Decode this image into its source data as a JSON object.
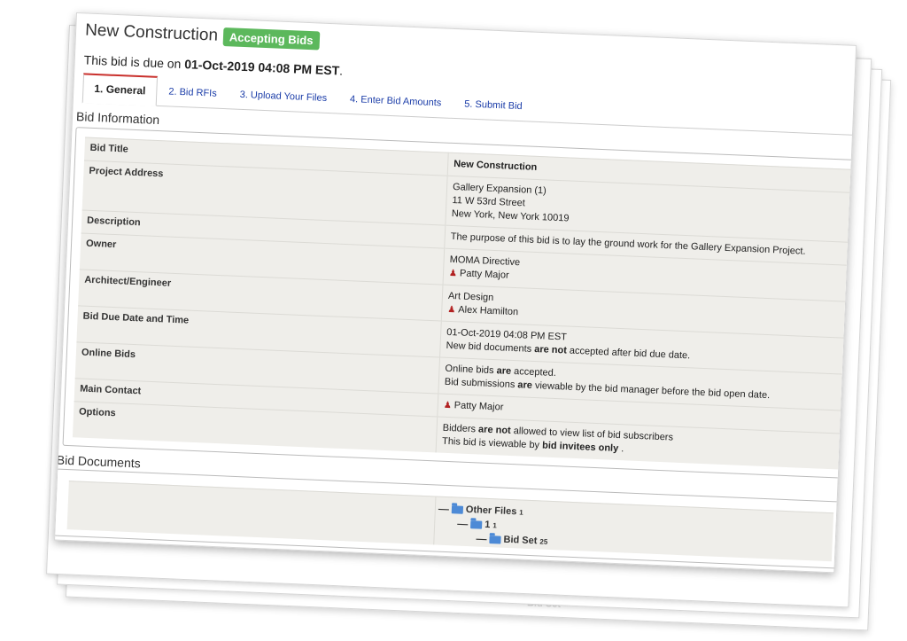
{
  "header": {
    "title": "New Construction",
    "status_badge": "Accepting Bids"
  },
  "due": {
    "prefix": "This bid is due on",
    "date": "01-Oct-2019 04:08 PM EST",
    "suffix": "."
  },
  "tabs": [
    {
      "label": "1. General",
      "active": true
    },
    {
      "label": "2. Bid RFIs",
      "active": false
    },
    {
      "label": "3. Upload Your Files",
      "active": false
    },
    {
      "label": "4. Enter Bid Amounts",
      "active": false
    },
    {
      "label": "5. Submit Bid",
      "active": false
    }
  ],
  "bid_information": {
    "heading": "Bid Information",
    "rows": {
      "bid_title": {
        "label": "Bid Title",
        "value": "New Construction"
      },
      "project_address": {
        "label": "Project Address",
        "line1": "Gallery Expansion (1)",
        "line2": "11 W 53rd Street",
        "line3": "New York, New York 10019"
      },
      "description": {
        "label": "Description",
        "value": "The purpose of this bid is to lay the ground work for the Gallery Expansion Project."
      },
      "owner": {
        "label": "Owner",
        "company": "MOMA Directive",
        "person": "Patty Major"
      },
      "architect": {
        "label": "Architect/Engineer",
        "company": "Art Design",
        "person": "Alex Hamilton"
      },
      "due_date": {
        "label": "Bid Due Date and Time",
        "line1": "01-Oct-2019 04:08 PM EST",
        "line2_a": "New bid documents ",
        "line2_b": "are not",
        "line2_c": " accepted after bid due date."
      },
      "online_bids": {
        "label": "Online Bids",
        "line1_a": "Online bids ",
        "line1_b": "are",
        "line1_c": " accepted.",
        "line2_a": "Bid submissions ",
        "line2_b": "are",
        "line2_c": " viewable by the bid manager before the bid open date."
      },
      "main_contact": {
        "label": "Main Contact",
        "person": "Patty Major"
      },
      "options": {
        "label": "Options",
        "line1_a": "Bidders ",
        "line1_b": "are not",
        "line1_c": " allowed to view list of bid subscribers",
        "line2_a": "This bid is viewable by ",
        "line2_b": "bid invitees only",
        "line2_c": " ."
      }
    }
  },
  "bid_documents": {
    "heading": "Bid Documents",
    "tree": [
      {
        "name": "Other Files",
        "count": "1"
      },
      {
        "name": "1",
        "count": "1"
      },
      {
        "name": "Bid Set",
        "count": "25"
      }
    ]
  },
  "ghost_text": "Bid Set"
}
